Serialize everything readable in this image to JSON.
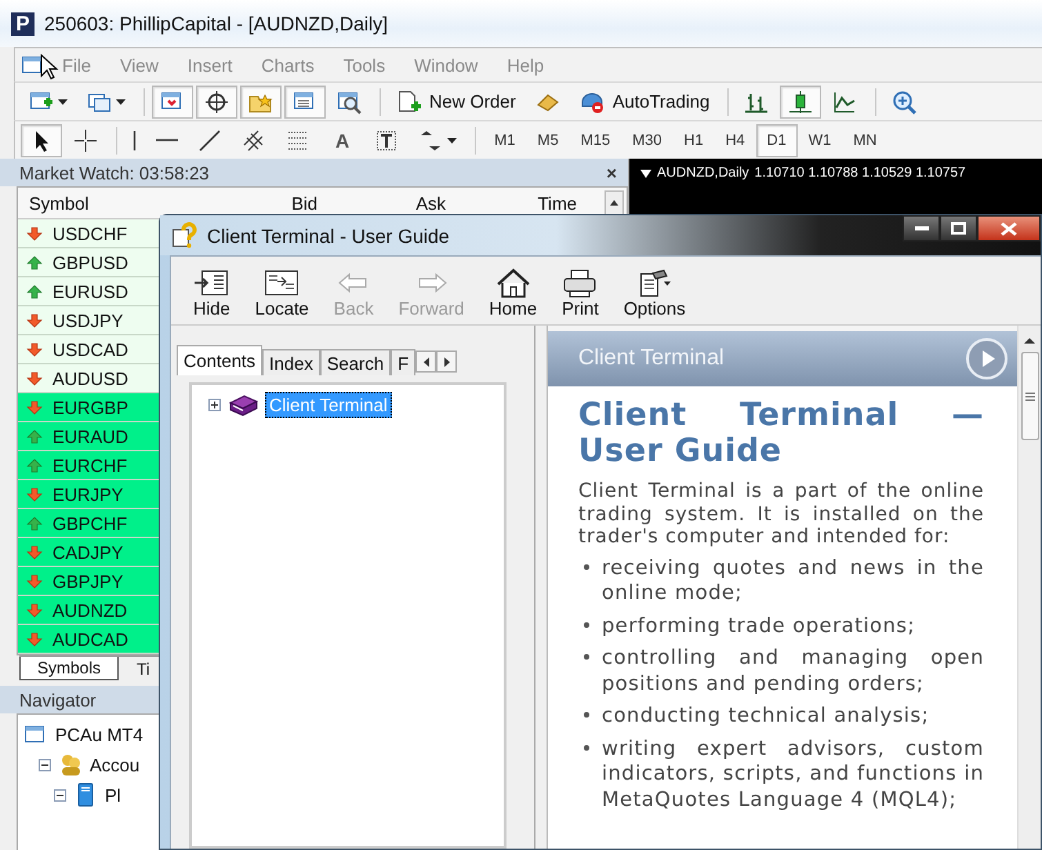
{
  "window": {
    "logo": "P",
    "title": "250603: PhillipCapital - [AUDNZD,Daily]"
  },
  "menu": [
    "File",
    "View",
    "Insert",
    "Charts",
    "Tools",
    "Window",
    "Help"
  ],
  "toolbar": [
    {
      "kind": "new-chart",
      "pressed": false,
      "dropdown": true
    },
    {
      "kind": "profiles",
      "pressed": false,
      "dropdown": true
    },
    {
      "kind": "separator"
    },
    {
      "kind": "market-watch",
      "pressed": true
    },
    {
      "kind": "data-window",
      "pressed": true
    },
    {
      "kind": "navigator",
      "pressed": true
    },
    {
      "kind": "terminal",
      "pressed": true
    },
    {
      "kind": "tester",
      "pressed": false
    },
    {
      "kind": "separator"
    },
    {
      "kind": "new-order",
      "label": "New Order",
      "pressed": false
    },
    {
      "kind": "ingot",
      "pressed": false
    },
    {
      "kind": "auto-trading",
      "label": "AutoTrading",
      "pressed": false
    },
    {
      "kind": "separator"
    },
    {
      "kind": "bar-chart",
      "pressed": false
    },
    {
      "kind": "candle",
      "pressed": true
    },
    {
      "kind": "line-chart",
      "pressed": false
    },
    {
      "kind": "separator"
    },
    {
      "kind": "zoom-in",
      "pressed": false
    }
  ],
  "drawing_toolbar": [
    {
      "kind": "cursor",
      "pressed": true
    },
    {
      "kind": "crosshair",
      "pressed": false
    },
    {
      "kind": "separator"
    },
    {
      "kind": "vline",
      "pressed": false
    },
    {
      "kind": "hline",
      "pressed": false
    },
    {
      "kind": "trendline",
      "pressed": false
    },
    {
      "kind": "channel",
      "pressed": false
    },
    {
      "kind": "fibo",
      "pressed": false
    },
    {
      "kind": "text",
      "label": "A",
      "pressed": false
    },
    {
      "kind": "text-label",
      "pressed": false
    },
    {
      "kind": "arrows",
      "pressed": false,
      "dropdown": true
    },
    {
      "kind": "separator"
    }
  ],
  "periods": [
    {
      "label": "M1",
      "selected": false
    },
    {
      "label": "M5",
      "selected": false
    },
    {
      "label": "M15",
      "selected": false
    },
    {
      "label": "M30",
      "selected": false
    },
    {
      "label": "H1",
      "selected": false
    },
    {
      "label": "H4",
      "selected": false
    },
    {
      "label": "D1",
      "selected": true
    },
    {
      "label": "W1",
      "selected": false
    },
    {
      "label": "MN",
      "selected": false
    }
  ],
  "market_watch": {
    "title": "Market Watch: 03:58:23",
    "close": "×",
    "columns": [
      "Symbol",
      "Bid",
      "Ask",
      "Time"
    ],
    "rows": [
      {
        "symbol": "USDCHF",
        "rising": false,
        "highlighted": false
      },
      {
        "symbol": "GBPUSD",
        "rising": true,
        "highlighted": false
      },
      {
        "symbol": "EURUSD",
        "rising": true,
        "highlighted": false
      },
      {
        "symbol": "USDJPY",
        "rising": false,
        "highlighted": false
      },
      {
        "symbol": "USDCAD",
        "rising": false,
        "highlighted": false
      },
      {
        "symbol": "AUDUSD",
        "rising": false,
        "highlighted": false
      },
      {
        "symbol": "EURGBP",
        "rising": false,
        "highlighted": true
      },
      {
        "symbol": "EURAUD",
        "rising": true,
        "highlighted": true
      },
      {
        "symbol": "EURCHF",
        "rising": true,
        "highlighted": true
      },
      {
        "symbol": "EURJPY",
        "rising": false,
        "highlighted": true
      },
      {
        "symbol": "GBPCHF",
        "rising": true,
        "highlighted": true
      },
      {
        "symbol": "CADJPY",
        "rising": false,
        "highlighted": true
      },
      {
        "symbol": "GBPJPY",
        "rising": false,
        "highlighted": true
      },
      {
        "symbol": "AUDNZD",
        "rising": false,
        "highlighted": true
      },
      {
        "symbol": "AUDCAD",
        "rising": false,
        "highlighted": true
      }
    ],
    "tabs": [
      {
        "label": "Symbols",
        "selected": true
      },
      {
        "label": "Ti",
        "selected": false
      }
    ]
  },
  "navigator": {
    "title": "Navigator",
    "tree": [
      {
        "label": "PCAu MT4",
        "children": [
          {
            "label": "Accou",
            "expanded": true,
            "children": [
              {
                "label": "Pl",
                "expanded": true
              }
            ]
          }
        ]
      }
    ]
  },
  "chart": {
    "symbol": "AUDNZD,Daily",
    "prices": "1.10710 1.10788 1.10529 1.10757"
  },
  "help": {
    "title": "Client Terminal - User Guide",
    "toolbar": [
      {
        "kind": "hide",
        "label": "Hide",
        "disabled": false
      },
      {
        "kind": "locate",
        "label": "Locate",
        "disabled": false
      },
      {
        "kind": "back",
        "label": "Back",
        "disabled": true
      },
      {
        "kind": "forward",
        "label": "Forward",
        "disabled": true
      },
      {
        "kind": "home",
        "label": "Home",
        "disabled": false
      },
      {
        "kind": "print",
        "label": "Print",
        "disabled": false
      },
      {
        "kind": "options",
        "label": "Options",
        "disabled": false
      }
    ],
    "tabs": [
      {
        "label": "Contents",
        "selected": true
      },
      {
        "label": "Index",
        "selected": false
      },
      {
        "label": "Search",
        "selected": false
      },
      {
        "label": "F",
        "selected": false
      }
    ],
    "tree": [
      {
        "label": "Client Terminal",
        "expanded": false,
        "selected": true
      }
    ],
    "topic": {
      "header": "Client Terminal",
      "heading": "Client Terminal — User Guide",
      "intro": "Client Terminal is a part of the online trading system. It is installed on the trader's computer and intended for:",
      "bullets": [
        "receiving quotes and news in the online mode;",
        "performing trade operations;",
        "controlling and managing open positions and pending orders;",
        "conducting technical analysis;",
        "writing expert advisors, custom indicators, scripts, and functions in MetaQuotes Language 4 (MQL4);"
      ]
    }
  }
}
